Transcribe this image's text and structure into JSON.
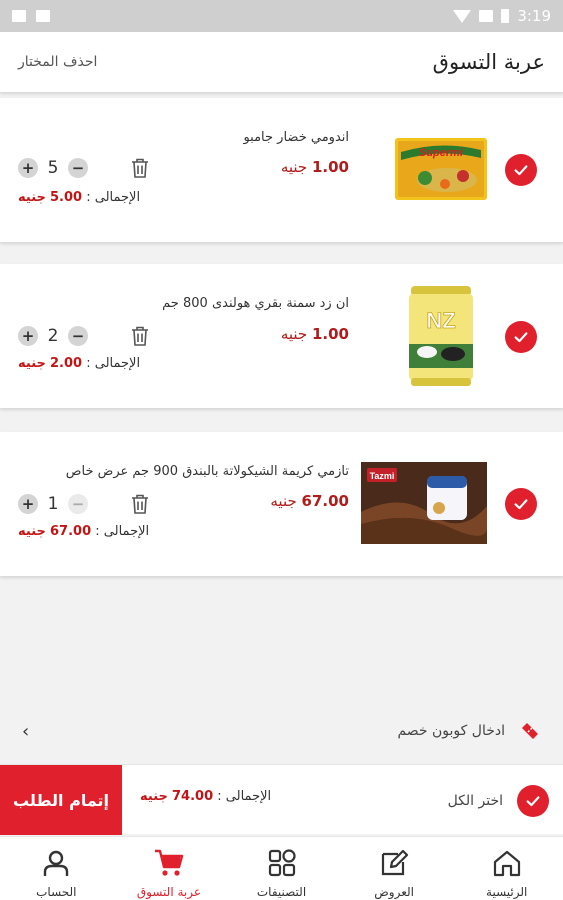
{
  "status_bar": {
    "time": "3:19"
  },
  "header": {
    "title": "عربة التسوق",
    "action": "احذف المختار"
  },
  "cart": {
    "items": [
      {
        "name": "اندومي خضار جامبو",
        "price": "1.00",
        "currency": "جنيه",
        "qty": "5",
        "total_label": "الإجمالى :",
        "total": "5.00",
        "total_currency": "جنيه",
        "selected": true,
        "thumb_text": "Supermi"
      },
      {
        "name": "ان زد سمنة بقري هولندى 800 جم",
        "price": "1.00",
        "currency": "جنيه",
        "qty": "2",
        "total_label": "الإجمالى :",
        "total": "2.00",
        "total_currency": "جنيه",
        "selected": true,
        "thumb_text": "NZ"
      },
      {
        "name": "تازمي كريمة الشيكولاتة بالبندق 900 جم عرض خاص",
        "price": "67.00",
        "currency": "جنيه",
        "qty": "1",
        "total_label": "الإجمالى :",
        "total": "67.00",
        "total_currency": "جنيه",
        "selected": true,
        "thumb_text": "Tazmi"
      }
    ]
  },
  "coupon": {
    "label": "ادخال كوبون خصم"
  },
  "summary": {
    "checkout_label": "إتمام الطلب",
    "total_label": "الإجمالى :",
    "total_value": "74.00",
    "currency": "جنيه",
    "select_all_label": "اختر الكل"
  },
  "nav": {
    "items": [
      {
        "label": "الرئيسية",
        "icon": "home-icon"
      },
      {
        "label": "العروض",
        "icon": "offers-icon"
      },
      {
        "label": "التصنيفات",
        "icon": "categories-icon"
      },
      {
        "label": "عربة التسوق",
        "icon": "cart-icon",
        "active": true
      },
      {
        "label": "الحساب",
        "icon": "account-icon"
      }
    ]
  },
  "colors": {
    "accent": "#e0202c",
    "price": "#b01b1b",
    "total": "#c21414"
  }
}
